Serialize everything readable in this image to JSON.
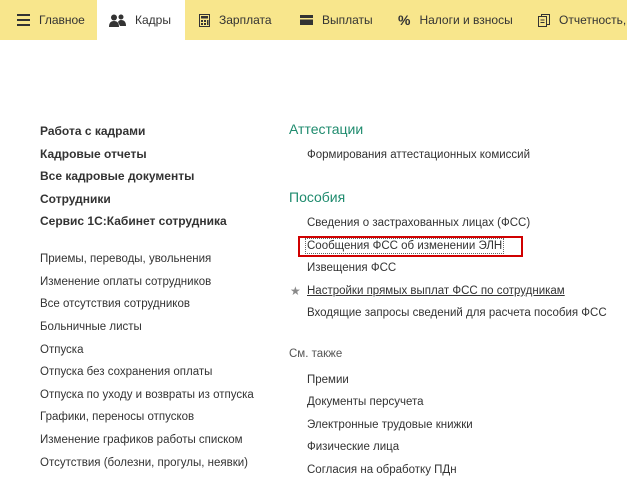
{
  "tabs": [
    {
      "label": "Главное",
      "icon": "menu-icon"
    },
    {
      "label": "Кадры",
      "icon": "people-icon"
    },
    {
      "label": "Зарплата",
      "icon": "calculator-icon"
    },
    {
      "label": "Выплаты",
      "icon": "wallet-icon"
    },
    {
      "label": "Налоги и взносы",
      "icon": "percent-icon"
    },
    {
      "label": "Отчетность, с",
      "icon": "reports-icon"
    }
  ],
  "active_tab": "Кадры",
  "left": {
    "main_links": [
      "Работа с кадрами",
      "Кадровые отчеты",
      "Все кадровые документы",
      "Сотрудники",
      "Сервис 1С:Кабинет сотрудника"
    ],
    "links": [
      "Приемы, переводы, увольнения",
      "Изменение оплаты сотрудников",
      "Все отсутствия сотрудников",
      "Больничные листы",
      "Отпуска",
      "Отпуска без сохранения оплаты",
      "Отпуска по уходу и возвраты из отпуска",
      "Графики, переносы отпусков",
      "Изменение графиков работы списком",
      "Отсутствия (болезни, прогулы, неявки)"
    ]
  },
  "right": {
    "attestation": {
      "title": "Аттестации",
      "links": [
        "Формирования аттестационных комиссий"
      ]
    },
    "benefits": {
      "title": "Пособия",
      "links": [
        "Сведения о застрахованных лицах (ФСС)",
        "Сообщения ФСС об изменении ЭЛН",
        "Извещения ФСС",
        "Настройки прямых выплат ФСС по сотрудникам",
        "Входящие запросы сведений для расчета пособия ФСС"
      ]
    },
    "see_also": {
      "title": "См. также",
      "links": [
        "Премии",
        "Документы персучета",
        "Электронные трудовые книжки",
        "Физические лица",
        "Согласия на обработку ПДн"
      ]
    }
  },
  "colors": {
    "topbar": "#f8e68c",
    "group_title": "#1f8b6e",
    "highlight_border": "#d00000"
  }
}
